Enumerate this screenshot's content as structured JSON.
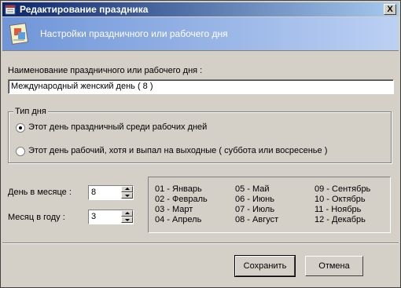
{
  "window": {
    "title": "Редактирование праздника",
    "close": "X"
  },
  "header": {
    "text": "Настройки праздничного или рабочего дня"
  },
  "name": {
    "label": "Наименование праздничного или рабочего дня :",
    "value": "Международный женский день ( 8 )"
  },
  "day_type": {
    "legend": "Тип дня",
    "options": [
      "Этот день праздничный среди рабочих дней",
      "Этот день рабочий, хотя и выпал на выходные ( суббота или восресенье )"
    ],
    "selected_index": 0
  },
  "day_field": {
    "label": "День в месяце :",
    "value": "8"
  },
  "month_field": {
    "label": "Месяц в году :",
    "value": "3"
  },
  "months": [
    "01 - Январь",
    "02 - Февраль",
    "03 - Март",
    "04 - Апрель",
    "05 - Май",
    "06 - Июнь",
    "07 - Июль",
    "08 - Август",
    "09 - Сентябрь",
    "10 - Октябрь",
    "11 - Ноябрь",
    "12 - Декабрь"
  ],
  "buttons": {
    "save": "Сохранить",
    "cancel": "Отмена"
  },
  "icons": {
    "app": "calendar-icon",
    "header": "note-icon",
    "close": "close-icon",
    "spin_up": "arrow-up-icon",
    "spin_down": "arrow-down-icon"
  },
  "colors": {
    "title_start": "#0a246a",
    "title_end": "#a6caf0",
    "header_start": "#6f95d8",
    "face": "#d4d0c8"
  }
}
